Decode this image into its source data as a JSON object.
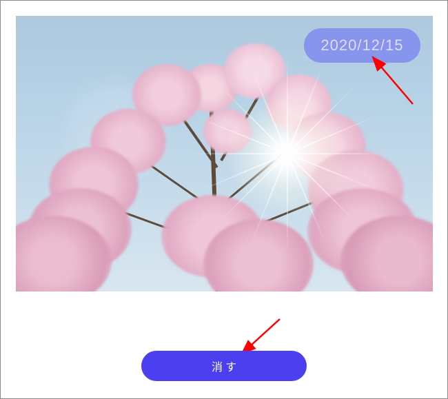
{
  "image": {
    "date_watermark": "2020/12/15"
  },
  "actions": {
    "erase_label": "消す"
  },
  "colors": {
    "accent": "#4b3ff0",
    "badge": "rgba(120,130,240,0.75)"
  }
}
